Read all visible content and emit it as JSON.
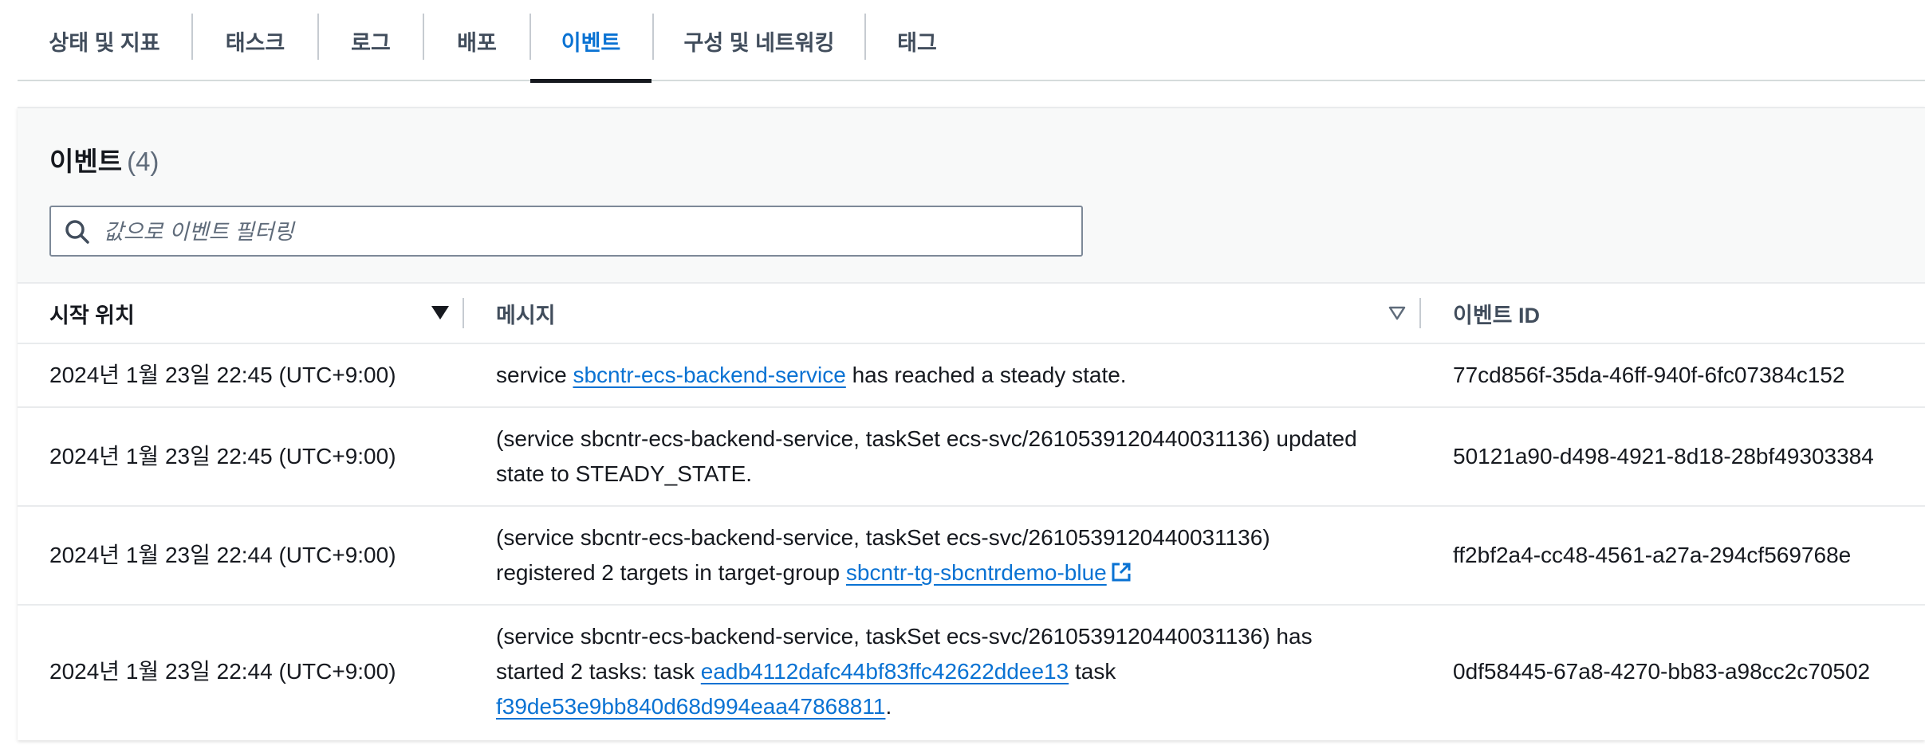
{
  "tabs": [
    {
      "label": "상태 및 지표",
      "active": false
    },
    {
      "label": "태스크",
      "active": false
    },
    {
      "label": "로그",
      "active": false
    },
    {
      "label": "배포",
      "active": false
    },
    {
      "label": "이벤트",
      "active": true
    },
    {
      "label": "구성 및 네트워킹",
      "active": false
    },
    {
      "label": "태그",
      "active": false
    }
  ],
  "events": {
    "title": "이벤트",
    "count": "(4)",
    "filter_placeholder": "값으로 이벤트 필터링",
    "search_icon": "search-icon",
    "columns": {
      "start": "시작 위치",
      "message": "메시지",
      "event_id": "이벤트 ID"
    },
    "rows": [
      {
        "time": "2024년 1월 23일 22:45 (UTC+9:00)",
        "msg_pre": "service ",
        "msg_link": "sbcntr-ecs-backend-service",
        "msg_post": " has reached a steady state.",
        "event_id": "77cd856f-35da-46ff-940f-6fc07384c152"
      },
      {
        "time": "2024년 1월 23일 22:45 (UTC+9:00)",
        "msg_line1": "(service sbcntr-ecs-backend-service, taskSet ecs-svc/2610539120440031136) updated",
        "msg_line2": "state to STEADY_STATE.",
        "event_id": "50121a90-d498-4921-8d18-28bf49303384"
      },
      {
        "time": "2024년 1월 23일 22:44 (UTC+9:00)",
        "msg_line1": "(service sbcntr-ecs-backend-service, taskSet ecs-svc/2610539120440031136)",
        "msg_line2_pre": "registered 2 targets in target-group ",
        "msg_link": "sbcntr-tg-sbcntrdemo-blue",
        "external_icon": "external-link-icon",
        "event_id": "ff2bf2a4-cc48-4561-a27a-294cf569768e"
      },
      {
        "time": "2024년 1월 23일 22:44 (UTC+9:00)",
        "msg_line1": "(service sbcntr-ecs-backend-service, taskSet ecs-svc/2610539120440031136) has",
        "msg_line2_pre": "started 2 tasks: task ",
        "msg_link1": "eadb4112dafc44bf83ffc42622ddee13",
        "msg_line2_mid": " task",
        "msg_link2": "f39de53e9bb840d68d994eaa47868811",
        "msg_line3_post": ".",
        "event_id": "0df58445-67a8-4270-bb83-a98cc2c70502"
      }
    ]
  },
  "colors": {
    "accent": "#0972d3",
    "text": "#16191f",
    "muted": "#5f6b7a",
    "border": "#e9ebed"
  }
}
